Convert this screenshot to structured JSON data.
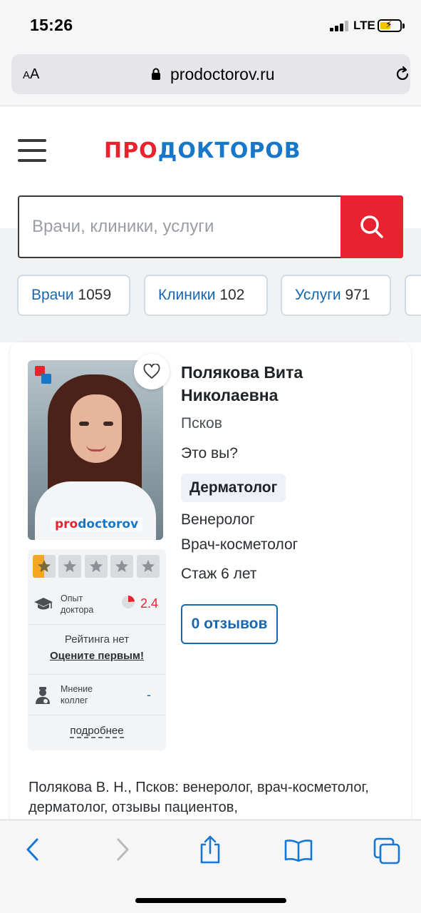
{
  "status_bar": {
    "time": "15:26",
    "network": "LTE"
  },
  "browser": {
    "text_size_label": "AA",
    "url": "prodoctorov.ru"
  },
  "site": {
    "logo_part1": "ПРО",
    "logo_part2": "ДОКТОРОВ",
    "search": {
      "placeholder": "Врачи, клиники, услуги"
    },
    "tabs": [
      {
        "label": "Врачи",
        "count": "1059"
      },
      {
        "label": "Клиники",
        "count": "102"
      },
      {
        "label": "Услуги",
        "count": "971"
      }
    ],
    "colors": {
      "brand_red": "#e8222f",
      "brand_blue": "#1877c8",
      "link_blue": "#1767b3"
    }
  },
  "doctor": {
    "name": "Полякова Вита Николаевна",
    "city": "Псков",
    "is_you": "Это вы?",
    "specialties": [
      "Дерматолог",
      "Венеролог",
      "Врач-косметолог"
    ],
    "experience": "Стаж 6 лет",
    "reviews_button": "0 отзывов",
    "photo_watermark_red": "pro",
    "photo_watermark_blue": "doctorov",
    "rating": {
      "stars_filled": 0.5,
      "stars_total": 5,
      "experience_label": "Опыт доктора",
      "experience_value": "2.4",
      "experience_fraction": 0.24,
      "no_rating": "Рейтинга нет",
      "rate_first": "Оцените первым!",
      "colleagues_label": "Мнение коллег",
      "colleagues_value": "-",
      "more": "подробнее"
    },
    "description": "Полякова В. Н., Псков: венеролог, врач-косметолог, дерматолог, отзывы пациентов,"
  }
}
